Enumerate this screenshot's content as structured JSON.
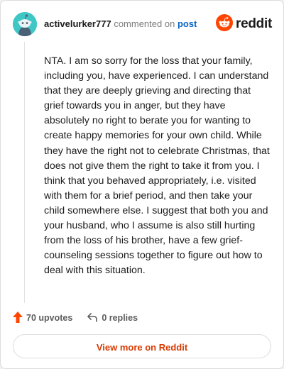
{
  "header": {
    "username": "activelurker777",
    "action_text": "commented on",
    "post_link": "post",
    "brand_wordmark": "reddit"
  },
  "comment": {
    "body": "NTA. I am so sorry for the loss that your family, including you, have experienced. I can understand that they are deeply grieving and directing that grief towards you in anger, but they have absolutely no right to berate you for wanting to create happy memories for your own child. While they have the right not to celebrate Christmas, that does not give them the right to take it from you. I think that you behaved appropriately, i.e. visited with them for a brief period, and then take your child somewhere else. I suggest that both you and your husband, who I assume is also still hurting from the loss of his brother, have a few grief-counseling sessions together to figure out how to deal with this situation."
  },
  "actions": {
    "upvotes": "70 upvotes",
    "replies": "0 replies"
  },
  "footer": {
    "view_more": "View more on Reddit"
  },
  "colors": {
    "brand_orange": "#ff4500",
    "avatar_bg": "#3fc7c6",
    "link_blue": "#0a66c2",
    "view_more_text": "#d93a00"
  },
  "icons": {
    "avatar": "snoo-avatar-icon",
    "brand": "reddit-logo-icon",
    "upvote": "upvote-arrow-icon",
    "reply": "reply-arrow-icon"
  }
}
